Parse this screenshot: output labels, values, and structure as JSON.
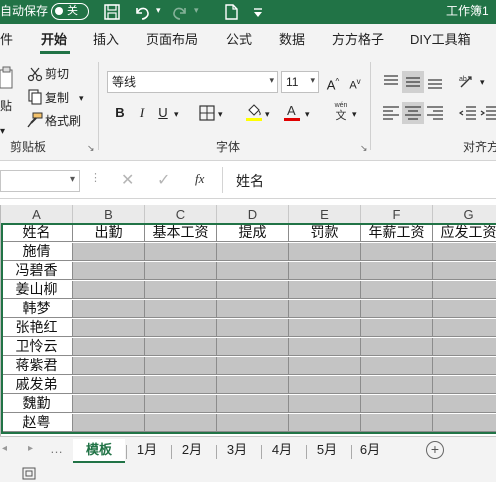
{
  "titlebar": {
    "autosave_label": "自动保存",
    "toggle_label": "关",
    "title": "工作簿1"
  },
  "tabs": [
    {
      "label": "件"
    },
    {
      "label": "开始"
    },
    {
      "label": "插入"
    },
    {
      "label": "页面布局"
    },
    {
      "label": "公式"
    },
    {
      "label": "数据"
    },
    {
      "label": "方方格子"
    },
    {
      "label": "DIY工具箱"
    }
  ],
  "clipboard": {
    "paste_label": "贴",
    "cut_label": "剪切",
    "copy_label": "复制",
    "format_painter_label": "格式刷",
    "group_label": "剪贴板"
  },
  "font": {
    "name": "等线",
    "size": "11",
    "grow_label": "A",
    "shrink_label": "A",
    "bold": "B",
    "italic": "I",
    "underline": "U",
    "group_label": "字体",
    "wen_label": "wén",
    "wen_char": "文"
  },
  "alignment": {
    "group_label": "对齐方"
  },
  "formula_bar": {
    "formula": "姓名",
    "fx_label": "fx"
  },
  "columns": [
    "A",
    "B",
    "C",
    "D",
    "E",
    "F",
    "G"
  ],
  "header_row": [
    "姓名",
    "出勤",
    "基本工资",
    "提成",
    "罚款",
    "年薪工资",
    "应发工资"
  ],
  "names": [
    "施倩",
    "冯碧香",
    "姜山柳",
    "韩梦",
    "张艳红",
    "卫怜云",
    "蒋紫君",
    "戚发弟",
    "魏勤",
    "赵粤"
  ],
  "sheet_tabs": [
    "模板",
    "1月",
    "2月",
    "3月",
    "4月",
    "5月",
    "6月"
  ],
  "colors": {
    "brand_green": "#217346",
    "cell_gray": "#c4c4c4"
  }
}
